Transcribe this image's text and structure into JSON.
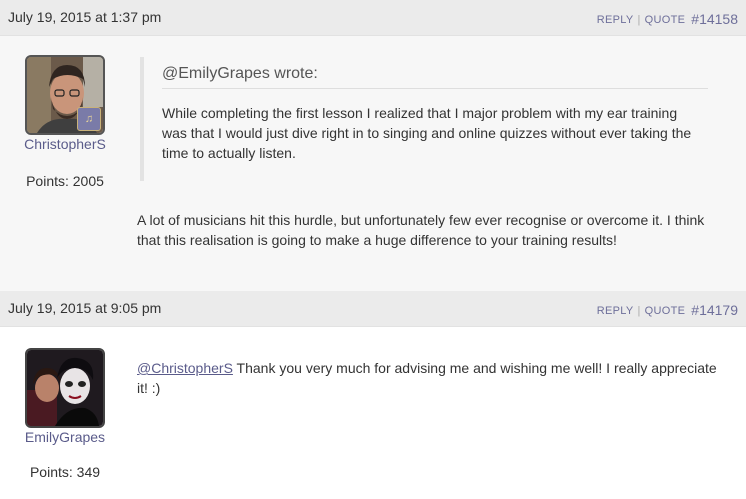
{
  "posts": [
    {
      "date": "July 19, 2015 at 1:37 pm",
      "reply_label": "REPLY",
      "quote_label": "QUOTE",
      "post_number": "#14158",
      "author": "ChristopherS",
      "points": "Points: 2005",
      "badge_text": "♫",
      "quote": {
        "header": "@EmilyGrapes wrote:",
        "text": "While completing the first lesson I realized that I major problem with my ear training was that I would just dive right in to singing and online quizzes without ever taking the time to actually listen."
      },
      "body": "A lot of musicians hit this hurdle, but unfortunately few ever recognise or overcome it. I think that this realisation is going to make a huge difference to your training results!"
    },
    {
      "date": "July 19, 2015 at 9:05 pm",
      "reply_label": "REPLY",
      "quote_label": "QUOTE",
      "post_number": "#14179",
      "author": "EmilyGrapes",
      "points": "Points: 349",
      "mention": "@ChristopherS",
      "body": " Thank you very much for advising me and wishing me well! I really appreciate it! :)"
    }
  ],
  "colors": {
    "accent": "#5a5b8a",
    "header_bg": "#ebebeb",
    "post_bg": "#f7f7f7"
  }
}
